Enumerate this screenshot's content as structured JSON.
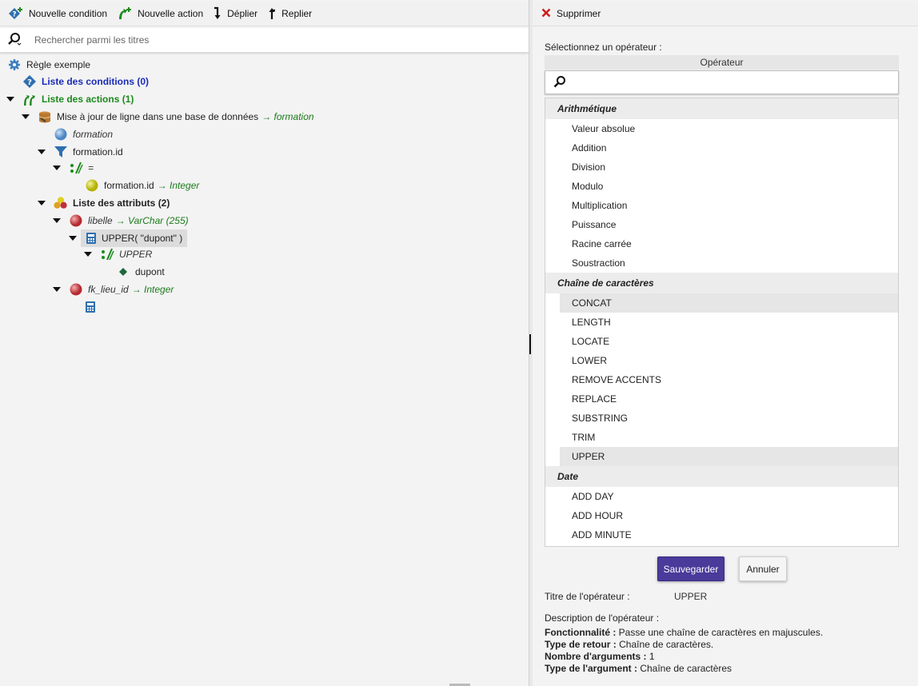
{
  "toolbar": {
    "new_condition": "Nouvelle condition",
    "new_action": "Nouvelle action",
    "expand": "Déplier",
    "collapse": "Replier"
  },
  "search": {
    "placeholder": "Rechercher parmi les titres"
  },
  "tree": {
    "root": "Règle exemple",
    "conditions": "Liste des conditions (0)",
    "actions": "Liste des actions (1)",
    "update_row": "Mise à jour de ligne dans une base de données",
    "update_row_target": "→ formation",
    "formation": "formation",
    "filter": "formation.id",
    "equals": "=",
    "field_id": "formation.id",
    "field_id_type": "→ Integer",
    "attributes": "Liste des attributs (2)",
    "libelle": "libelle",
    "libelle_type": "→ VarChar (255)",
    "expression": "UPPER( \"dupont\" )",
    "upper": "UPPER",
    "dupont": "dupont",
    "fk_lieu": "fk_lieu_id",
    "fk_lieu_type": "→ Integer"
  },
  "right": {
    "delete": "Supprimer",
    "select_label": "Sélectionnez un opérateur :",
    "op_header": "Opérateur",
    "groups": [
      {
        "name": "Arithmétique",
        "items": [
          "Valeur absolue",
          "Addition",
          "Division",
          "Modulo",
          "Multiplication",
          "Puissance",
          "Racine carrée",
          "Soustraction"
        ]
      },
      {
        "name": "Chaîne de caractères",
        "items": [
          "CONCAT",
          "LENGTH",
          "LOCATE",
          "LOWER",
          "REMOVE ACCENTS",
          "REPLACE",
          "SUBSTRING",
          "TRIM",
          "UPPER"
        ]
      },
      {
        "name": "Date",
        "items": [
          "ADD DAY",
          "ADD HOUR",
          "ADD MINUTE"
        ]
      }
    ],
    "hover_item": "CONCAT",
    "selected_item": "UPPER",
    "save": "Sauvegarder",
    "cancel": "Annuler",
    "title_label": "Titre de l'opérateur :",
    "title_value": "UPPER",
    "desc_label": "Description de l'opérateur :",
    "desc": {
      "func_label": "Fonctionnalité :",
      "func_value": "Passe une chaîne de caractères en majuscules.",
      "ret_label": "Type de retour :",
      "ret_value": "Chaîne de caractères.",
      "nargs_label": "Nombre d'arguments :",
      "nargs_value": "1",
      "argtype_label": "Type de l'argument :",
      "argtype_value": "Chaîne de caractères"
    }
  },
  "colors": {
    "accent": "#4a3a9a",
    "condition_blue": "#1a2bb8",
    "action_green": "#1b8a1b"
  }
}
